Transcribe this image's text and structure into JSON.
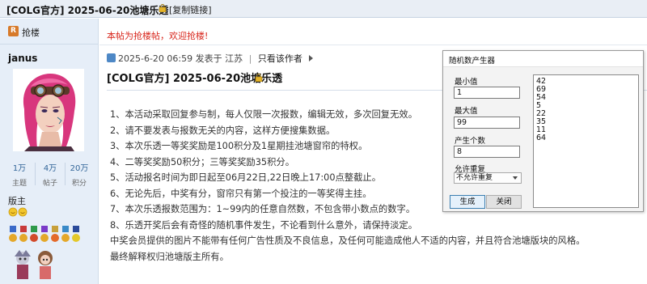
{
  "header": {
    "thread_title": "[COLG官方] 2025-06-20池塘乐透",
    "copy_link_label": "[复制链接]"
  },
  "sidebar": {
    "floor_label": "抢楼",
    "username": "janus",
    "stats": [
      {
        "value": "1万",
        "label": "主题"
      },
      {
        "value": "4万",
        "label": "帖子"
      },
      {
        "value": "20万",
        "label": "积分"
      }
    ],
    "rank": "版主"
  },
  "notice": {
    "text": "本帖为抢楼帖，欢迎抢楼!"
  },
  "post": {
    "date": "2025-6-20 06:59",
    "posted_in": "发表于 江苏",
    "only_author": "只看该作者",
    "title": "[COLG官方] 2025-06-20池塘乐透",
    "rules": [
      "1、本活动采取回复参与制，每人仅限一次报数，编辑无效，多次回复无效。",
      "2、请不要发表与报数无关的内容，这样方便搜集数据。",
      "3、本次乐透一等奖奖励是100积分及1星期挂池塘窗帘的特权。",
      "4、二等奖奖励50积分；三等奖奖励35积分。",
      "5、活动报名时间为即日起至06月22日,22日晚上17:00点整截止。",
      "6、无论先后，中奖有分，窗帘只有第一个投注的一等奖得主挂。",
      "7、本次乐透报数范围为：1~99内的任意自然数，不包含带小数点的数字。",
      "8、乐透开奖后会有奇怪的随机事件发生，不论看到什么意外，请保持淡定。",
      "中奖会员提供的图片不能带有任何广告性质及不良信息，及任何可能造成他人不适的内容，并且符合池塘版块的风格。",
      "最终解释权归池塘版主所有。"
    ]
  },
  "dialog": {
    "title": "随机数产生器",
    "min_label": "最小值",
    "min_value": "1",
    "max_label": "最大值",
    "max_value": "99",
    "count_label": "产生个数",
    "count_value": "8",
    "dup_label": "允许重复",
    "dup_selected": "不允许重复",
    "generate_label": "生成",
    "close_label": "关闭",
    "results": [
      "42",
      "69",
      "54",
      "5",
      "22",
      "35",
      "11",
      "64"
    ]
  }
}
